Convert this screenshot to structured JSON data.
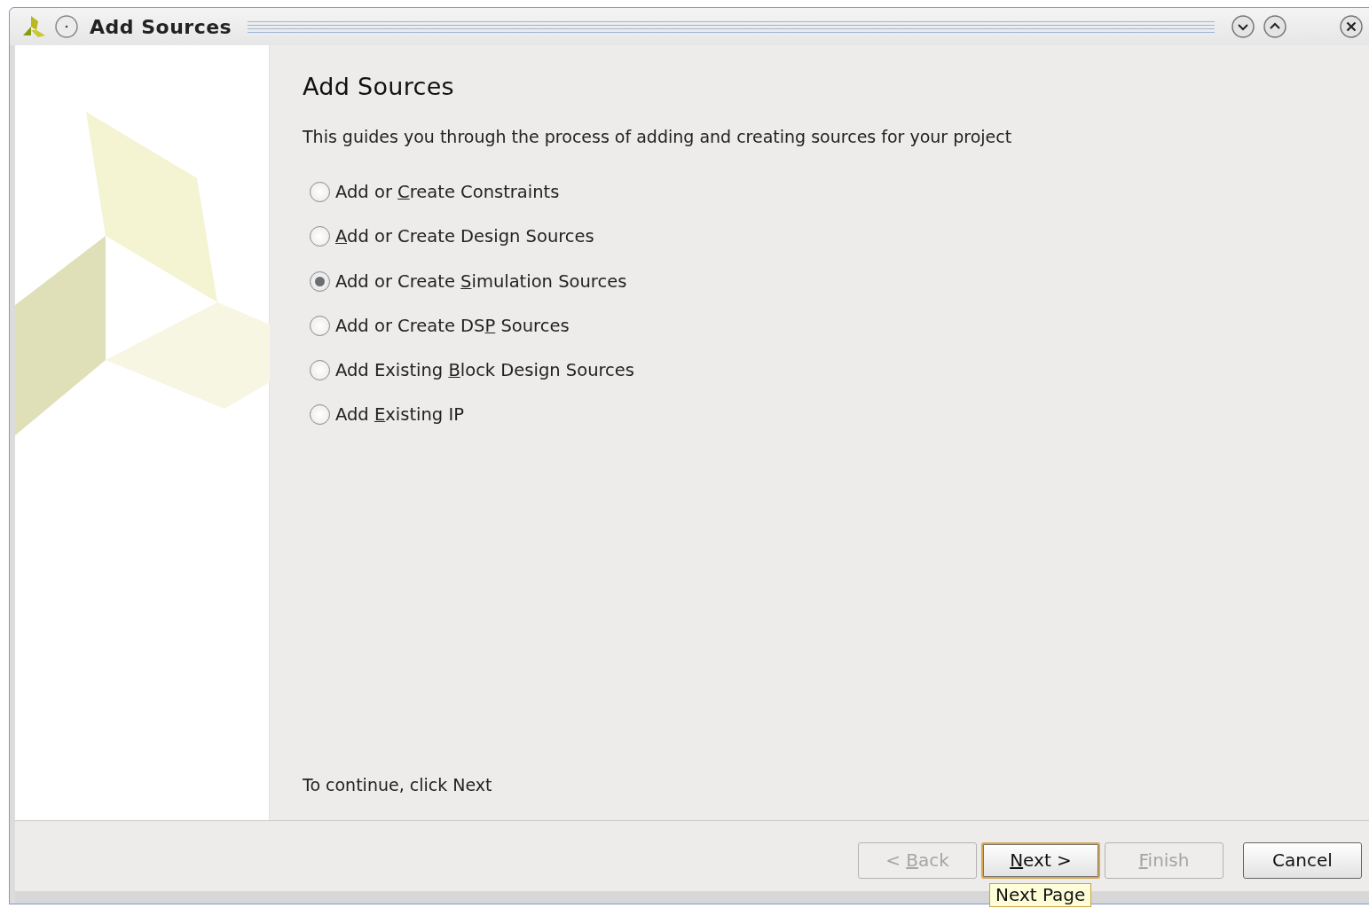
{
  "window": {
    "title": "Add Sources"
  },
  "heading": "Add Sources",
  "description": "This guides you through the process of adding and creating sources for your project",
  "options": [
    {
      "label_before": "Add or ",
      "mnemonic": "C",
      "label_after": "reate Constraints",
      "selected": false
    },
    {
      "mnemonic": "A",
      "label_after": "dd or Create Design Sources",
      "selected": false
    },
    {
      "label_before": "Add or Create ",
      "mnemonic": "S",
      "label_after": "imulation Sources",
      "selected": true
    },
    {
      "label_before": "Add or Create DS",
      "mnemonic": "P",
      "label_after": " Sources",
      "selected": false
    },
    {
      "label_before": "Add Existing ",
      "mnemonic": "B",
      "label_after": "lock Design Sources",
      "selected": false
    },
    {
      "label_before": "Add ",
      "mnemonic": "E",
      "label_after": "xisting IP",
      "selected": false
    }
  ],
  "footer_text": "To continue, click Next",
  "buttons": [
    {
      "label_before": "< ",
      "mnemonic": "B",
      "label_after": "ack",
      "disabled": true,
      "focused": false
    },
    {
      "mnemonic": "N",
      "label_after": "ext >",
      "disabled": false,
      "focused": true
    },
    {
      "mnemonic": "F",
      "label_after": "inish",
      "disabled": true,
      "focused": false
    },
    {
      "label_before": "Cancel",
      "disabled": false,
      "focused": false
    }
  ],
  "tooltip": "Next Page"
}
